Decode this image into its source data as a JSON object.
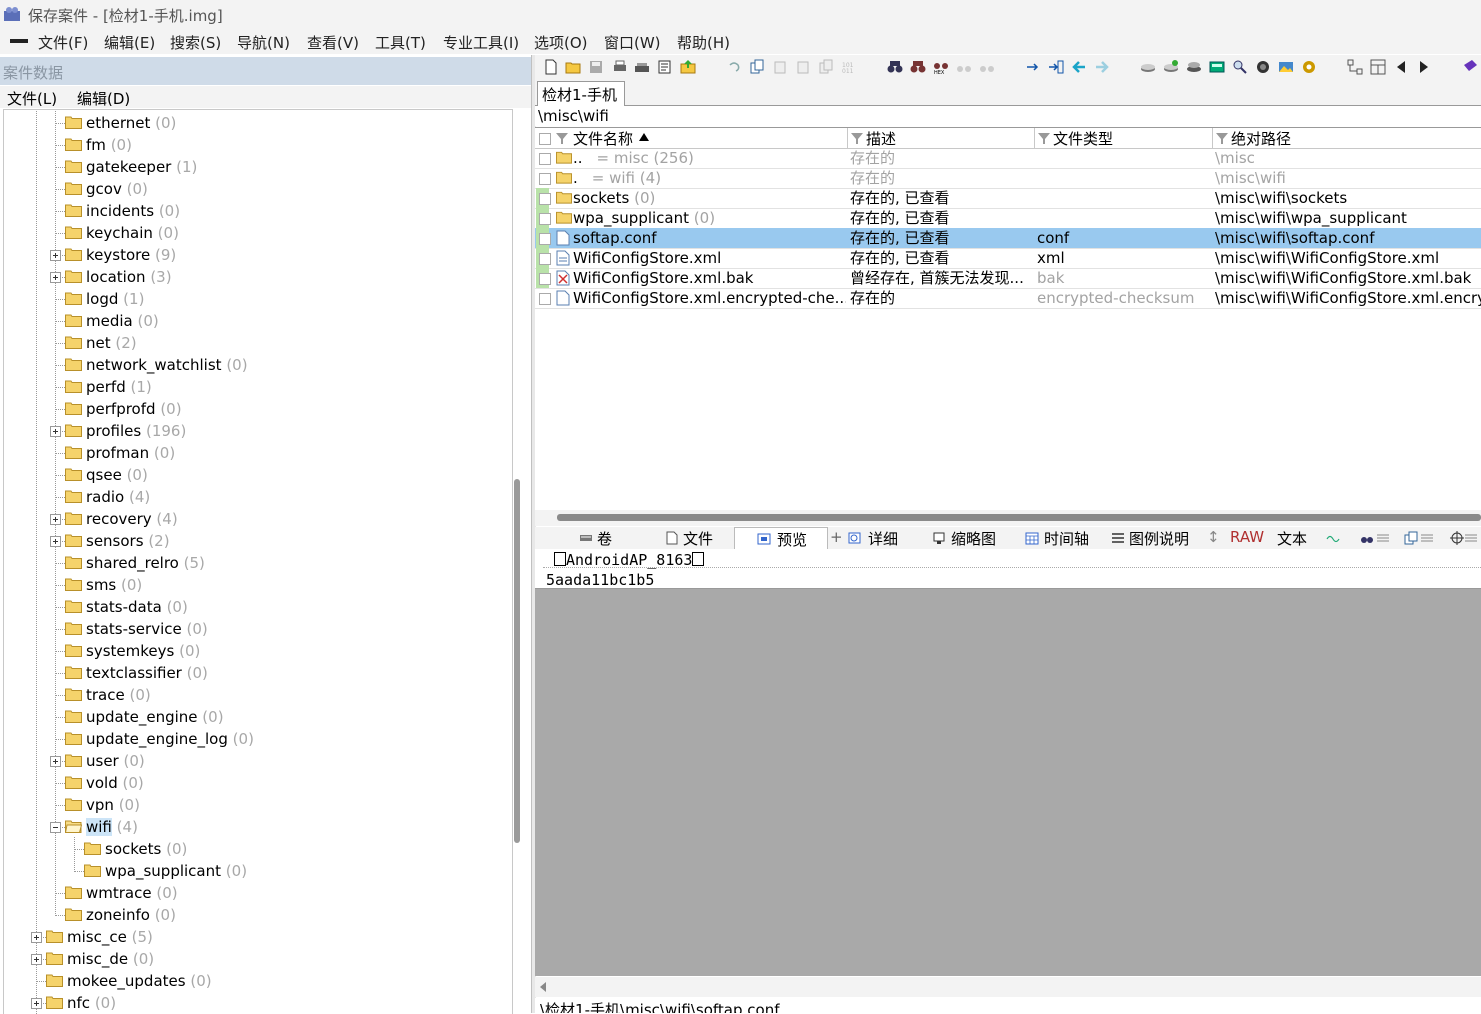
{
  "window": {
    "title": "保存案件 - [检材1-手机.img]"
  },
  "menubar": {
    "items": [
      "文件(F)",
      "编辑(E)",
      "搜索(S)",
      "导航(N)",
      "查看(V)",
      "工具(T)",
      "专业工具(I)",
      "选项(O)",
      "窗口(W)",
      "帮助(H)"
    ]
  },
  "left_panel": {
    "header": "案件数据",
    "menu": [
      "文件(L)",
      "编辑(D)"
    ],
    "tree": [
      {
        "name": "ethernet",
        "count": "(0)"
      },
      {
        "name": "fm",
        "count": "(0)"
      },
      {
        "name": "gatekeeper",
        "count": "(1)"
      },
      {
        "name": "gcov",
        "count": "(0)"
      },
      {
        "name": "incidents",
        "count": "(0)"
      },
      {
        "name": "keychain",
        "count": "(0)"
      },
      {
        "name": "keystore",
        "count": "(9)"
      },
      {
        "name": "location",
        "count": "(3)"
      },
      {
        "name": "logd",
        "count": "(1)"
      },
      {
        "name": "media",
        "count": "(0)"
      },
      {
        "name": "net",
        "count": "(2)"
      },
      {
        "name": "network_watchlist",
        "count": "(0)"
      },
      {
        "name": "perfd",
        "count": "(1)"
      },
      {
        "name": "perfprofd",
        "count": "(0)"
      },
      {
        "name": "profiles",
        "count": "(196)"
      },
      {
        "name": "profman",
        "count": "(0)"
      },
      {
        "name": "qsee",
        "count": "(0)"
      },
      {
        "name": "radio",
        "count": "(4)"
      },
      {
        "name": "recovery",
        "count": "(4)"
      },
      {
        "name": "sensors",
        "count": "(2)"
      },
      {
        "name": "shared_relro",
        "count": "(5)"
      },
      {
        "name": "sms",
        "count": "(0)"
      },
      {
        "name": "stats-data",
        "count": "(0)"
      },
      {
        "name": "stats-service",
        "count": "(0)"
      },
      {
        "name": "systemkeys",
        "count": "(0)"
      },
      {
        "name": "textclassifier",
        "count": "(0)"
      },
      {
        "name": "trace",
        "count": "(0)"
      },
      {
        "name": "update_engine",
        "count": "(0)"
      },
      {
        "name": "update_engine_log",
        "count": "(0)"
      },
      {
        "name": "user",
        "count": "(0)"
      },
      {
        "name": "vold",
        "count": "(0)"
      },
      {
        "name": "vpn",
        "count": "(0)"
      },
      {
        "name": "wifi",
        "count": "(4)"
      },
      {
        "name": "sockets",
        "count": "(0)"
      },
      {
        "name": "wpa_supplicant",
        "count": "(0)"
      },
      {
        "name": "wmtrace",
        "count": "(0)"
      },
      {
        "name": "zoneinfo",
        "count": "(0)"
      },
      {
        "name": "misc_ce",
        "count": "(5)"
      },
      {
        "name": "misc_de",
        "count": "(0)"
      },
      {
        "name": "mokee_updates",
        "count": "(0)"
      },
      {
        "name": "nfc",
        "count": "(0)"
      }
    ]
  },
  "right_panel": {
    "tab": "检材1-手机",
    "path": "\\misc\\wifi",
    "columns": [
      "文件名称",
      "描述",
      "文件类型",
      "绝对路径"
    ],
    "rows": [
      {
        "name": "..",
        "parent": "misc",
        "count": "(256)",
        "desc": "存在的",
        "type": "",
        "path": "\\misc"
      },
      {
        "name": ".",
        "parent": "wifi",
        "count": "(4)",
        "desc": "存在的",
        "type": "",
        "path": "\\misc\\wifi"
      },
      {
        "name": "sockets",
        "count": "(0)",
        "desc": "存在的, 已查看",
        "type": "",
        "path": "\\misc\\wifi\\sockets"
      },
      {
        "name": "wpa_supplicant",
        "count": "(0)",
        "desc": "存在的, 已查看",
        "type": "",
        "path": "\\misc\\wifi\\wpa_supplicant"
      },
      {
        "name": "softap.conf",
        "count": "",
        "desc": "存在的, 已查看",
        "type": "conf",
        "path": "\\misc\\wifi\\softap.conf"
      },
      {
        "name": "WifiConfigStore.xml",
        "count": "",
        "desc": "存在的, 已查看",
        "type": "xml",
        "path": "\\misc\\wifi\\WifiConfigStore.xml"
      },
      {
        "name": "WifiConfigStore.xml.bak",
        "count": "",
        "desc": "曾经存在, 首簇无法发现...",
        "type": "bak",
        "path": "\\misc\\wifi\\WifiConfigStore.xml.bak"
      },
      {
        "name": "WifiConfigStore.xml.encrypted-che...",
        "count": "",
        "desc": "存在的",
        "type": "encrypted-checksum",
        "path": "\\misc\\wifi\\WifiConfigStore.xml.encry"
      }
    ],
    "view_tabs": [
      "卷",
      "文件",
      "预览",
      "详细",
      "缩略图",
      "时间轴",
      "图例说明",
      "RAW",
      "文本"
    ],
    "preview": {
      "line1": "AndroidAP_8163",
      "line2": "5aada11bc1b5"
    },
    "status": "\\检材1-手机\\misc\\wifi\\softap.conf"
  },
  "colors": {
    "selection": "#99c9ef",
    "tree_selection": "#cce4f7",
    "viewed_mark": "#b9e2a9",
    "folder": "#f5d36b",
    "header_bg": "#cfdbe8"
  }
}
